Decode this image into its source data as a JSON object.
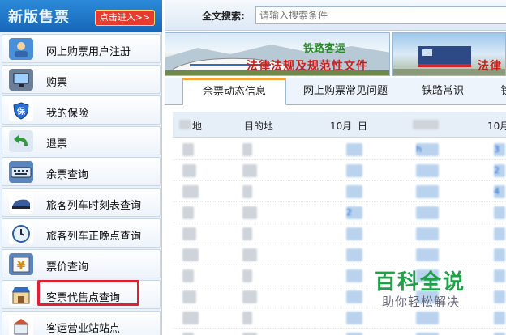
{
  "sidebar": {
    "title": "新版售票",
    "enter_label": "点击进入>>",
    "items": [
      {
        "label": "网上购票用户注册",
        "icon": "user-register-icon"
      },
      {
        "label": "购票",
        "icon": "computer-icon"
      },
      {
        "label": "我的保险",
        "icon": "shield-icon"
      },
      {
        "label": "退票",
        "icon": "return-arrow-icon"
      },
      {
        "label": "余票查询",
        "icon": "keyboard-icon"
      },
      {
        "label": "旅客列车时刻表查询",
        "icon": "train-icon"
      },
      {
        "label": "旅客列车正晚点查询",
        "icon": "clock-icon"
      },
      {
        "label": "票价查询",
        "icon": "yen-icon"
      },
      {
        "label": "客票代售点查询",
        "icon": "shop-icon"
      },
      {
        "label": "客运营业站站点",
        "icon": "station-icon"
      }
    ],
    "highlighted_index": 8
  },
  "search": {
    "label": "全文搜索:",
    "placeholder": "请输入搜索条件"
  },
  "banners": [
    {
      "top_text": "铁路客运",
      "bottom_text": "法律法规及规范性文件"
    },
    {
      "bottom_text": "法律"
    }
  ],
  "tabs": [
    "余票动态信息",
    "网上购票常见问题",
    "铁路常识",
    "铁"
  ],
  "table": {
    "headers": [
      "地",
      "目的地",
      "10月",
      "日",
      "10月"
    ],
    "row_count": 10,
    "rows": [
      {
        "c2": "",
        "c4": "h",
        "c6": "3"
      },
      {
        "c2": "",
        "c4": "",
        "c6": "2"
      },
      {
        "c2": "",
        "c4": "",
        "c6": "4"
      },
      {
        "c2": "2",
        "c4": "",
        "c6": ""
      },
      {
        "c2": "",
        "c4": "",
        "c6": ""
      },
      {
        "c2": "",
        "c4": "",
        "c6": ""
      },
      {
        "c2": "",
        "c4": "",
        "c6": ""
      },
      {
        "c2": "",
        "c4": "",
        "c6": ""
      },
      {
        "c2": "",
        "c4": "",
        "c6": ""
      },
      {
        "c2": "",
        "c4": "",
        "c6": ""
      }
    ]
  },
  "watermark": {
    "title": "百科全说",
    "subtitle": "助你轻松解决"
  },
  "colors": {
    "sidebar_header": "#1766b8",
    "highlight_border": "#e02030",
    "banner_text": "#c8201c",
    "watermark": "#21a04a",
    "tab_accent": "#f2a33a"
  }
}
